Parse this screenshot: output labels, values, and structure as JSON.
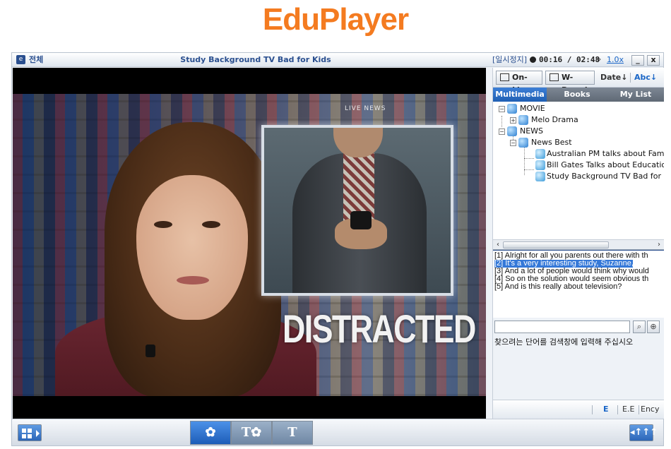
{
  "brand": {
    "name": "EduPlayer",
    "color": "#f47b20"
  },
  "titlebar": {
    "logo": "e",
    "full_label": "전체",
    "title": "Study Background TV Bad for Kids",
    "status": "[일시정지]",
    "time": "00:16 / 02:48",
    "ff_symbol": "»",
    "speed": "1.0x",
    "minimize": "_",
    "close": "x"
  },
  "video": {
    "inset_tag": "LIVE NEWS",
    "caption": "DISTRACTED"
  },
  "side_toolbar": {
    "online": "On-Line",
    "wboard": "W-Board",
    "date_sort": "Date↓",
    "abc_sort": "Abc↓"
  },
  "tabs": [
    {
      "label": "Multimedia"
    },
    {
      "label": "Books"
    },
    {
      "label": "My List"
    }
  ],
  "tree": {
    "movie": "MOVIE",
    "melo": "Melo Drama",
    "news": "NEWS",
    "news_best": "News Best",
    "item1": "Australian PM talks about Family",
    "item2": "Bill Gates Talks about Education",
    "item3": "Study Background TV Bad for Kids"
  },
  "subtitles": [
    "[1] Alright for all you parents out there with th",
    "[2] It's a very interesting study, Suzanne,",
    "[3] And a lot of people would think why would",
    "[4] So on the solution would seem obvious th",
    "[5] And is this really about television?"
  ],
  "search": {
    "value": "",
    "search_icon": "magnifier",
    "add_icon": "plus-circle",
    "hint": "찾으려는 단어를 검색창에 입력해 주십시오"
  },
  "dictionaries": {
    "e": "E",
    "ee": "E.E",
    "ency": "Ency"
  },
  "bottom": {
    "mode_video": "✿",
    "mode_text_video": "T✿",
    "mode_text": "T",
    "eq_label": "◂↑↑↑"
  },
  "colors": {
    "accent_blue": "#1f5fb3",
    "selected_line": "#3478d8"
  }
}
